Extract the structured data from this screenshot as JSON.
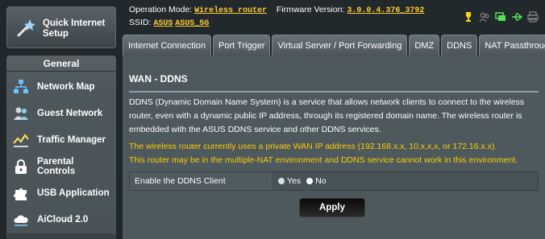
{
  "sidebar": {
    "quick_setup": "Quick Internet Setup",
    "section_title": "General",
    "items": [
      {
        "label": "Network Map"
      },
      {
        "label": "Guest Network"
      },
      {
        "label": "Traffic Manager"
      },
      {
        "label": "Parental Controls"
      },
      {
        "label": "USB Application"
      },
      {
        "label": "AiCloud 2.0"
      }
    ]
  },
  "topbar": {
    "op_mode_label": "Operation Mode:",
    "op_mode_value": "Wireless router",
    "fw_label": "Firmware Version:",
    "fw_value": "3.0.0.4.376_3792",
    "ssid_label": "SSID:",
    "ssid_1": "ASUS",
    "ssid_2": "ASUS_5G"
  },
  "tabs": [
    {
      "label": "Internet Connection",
      "active": false
    },
    {
      "label": "Port Trigger",
      "active": false
    },
    {
      "label": "Virtual Server / Port Forwarding",
      "active": false
    },
    {
      "label": "DMZ",
      "active": false
    },
    {
      "label": "DDNS",
      "active": true
    },
    {
      "label": "NAT Passthrough",
      "active": false
    }
  ],
  "panel": {
    "title": "WAN - DDNS",
    "description": "DDNS (Dynamic Domain Name System) is a service that allows network clients to connect to the wireless router, even with a dynamic public IP address, through its registered domain name. The wireless router is embedded with the ASUS DDNS service and other DDNS services.",
    "warning_1": "The wireless router currently uses a private WAN IP address (192.168.x.x, 10,x,x,x, or 172.16.x.x).",
    "warning_2": "This router may be in the multiple-NAT environment and DDNS service cannot work in this environment.",
    "field_label": "Enable the DDNS Client",
    "option_yes": "Yes",
    "option_no": "No",
    "selected": "Yes",
    "apply_label": "Apply"
  },
  "colors": {
    "warning_text": "#ffcc00",
    "link_text": "#ffcc33",
    "panel_bg": "#4d595d"
  }
}
